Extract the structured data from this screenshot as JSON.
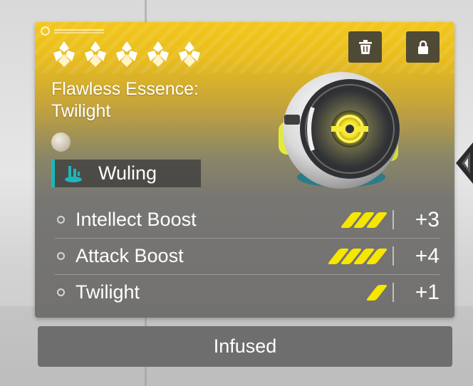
{
  "item": {
    "title_line1": "Flawless Essence:",
    "title_line2": "Twilight",
    "rarity_stars": 5,
    "faction": {
      "label": "Wuling",
      "accent_color": "#1fb6b9"
    },
    "accent_color": "#f3c71c"
  },
  "actions": {
    "delete_icon": "trash-icon",
    "lock_icon": "lock-icon"
  },
  "stats": [
    {
      "name": "Intellect Boost",
      "pips": 3,
      "value": "+3"
    },
    {
      "name": "Attack Boost",
      "pips": 4,
      "value": "+4"
    },
    {
      "name": "Twilight",
      "pips": 1,
      "value": "+1"
    }
  ],
  "status": {
    "label": "Infused"
  }
}
